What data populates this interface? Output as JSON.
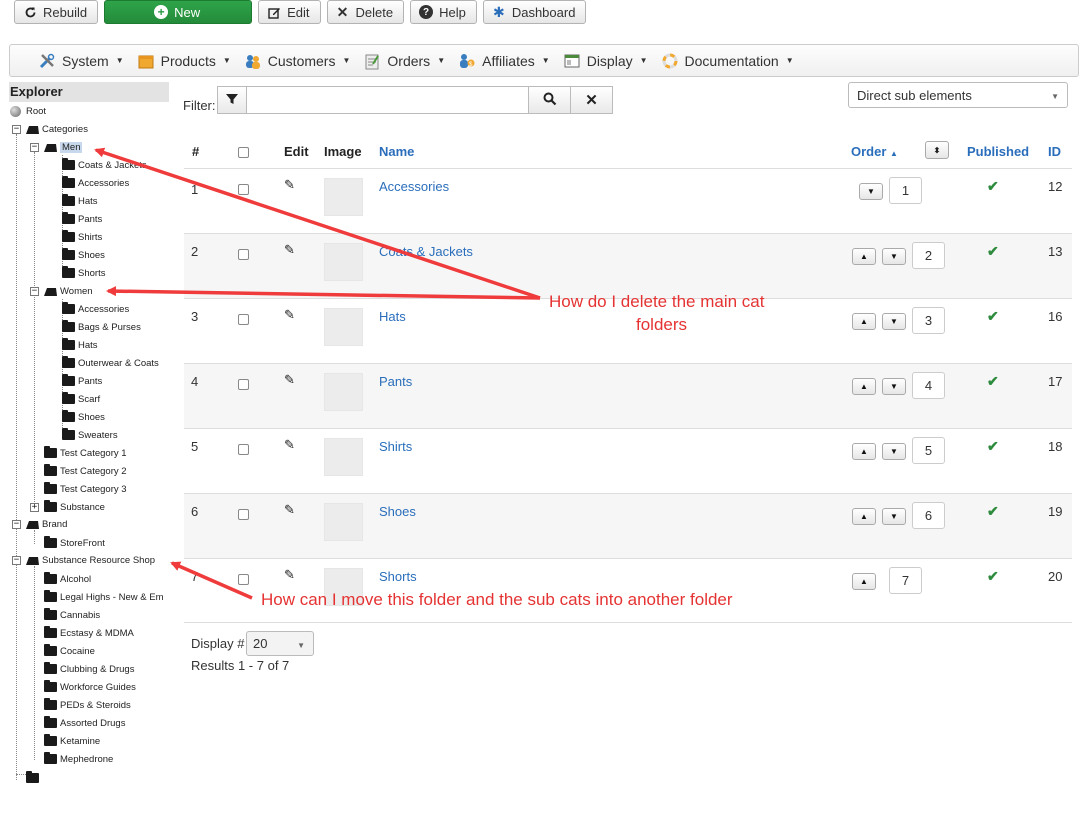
{
  "toolbar": {
    "rebuild": "Rebuild",
    "new": "New",
    "edit": "Edit",
    "delete": "Delete",
    "help": "Help",
    "dashboard": "Dashboard"
  },
  "menu": [
    "System",
    "Products",
    "Customers",
    "Orders",
    "Affiliates",
    "Display",
    "Documentation"
  ],
  "explorer": {
    "title": "Explorer",
    "root": "Root",
    "categories": "Categories",
    "men": "Men",
    "men_children": [
      "Coats & Jackets",
      "Accessories",
      "Hats",
      "Pants",
      "Shirts",
      "Shoes",
      "Shorts"
    ],
    "women": "Women",
    "women_children": [
      "Accessories",
      "Bags & Purses",
      "Hats",
      "Outerwear & Coats",
      "Pants",
      "Scarf",
      "Shoes",
      "Sweaters"
    ],
    "test_categories": [
      "Test Category 1",
      "Test Category 2",
      "Test Category 3"
    ],
    "substance": "Substance",
    "brand": "Brand",
    "storefront": "StoreFront",
    "substance_shop": "Substance Resource Shop",
    "shop_children": [
      "Alcohol",
      "Legal Highs - New & Em",
      "Cannabis",
      "Ecstasy & MDMA",
      "Cocaine",
      "Clubbing & Drugs",
      "Workforce Guides",
      "PEDs & Steroids",
      "Assorted Drugs",
      "Ketamine",
      "Mephedrone"
    ]
  },
  "filter": {
    "label": "Filter:",
    "value": "",
    "scope": "Direct sub elements"
  },
  "table": {
    "headers": {
      "num": "#",
      "edit": "Edit",
      "image": "Image",
      "name": "Name",
      "order": "Order",
      "published": "Published",
      "id": "ID"
    },
    "rows": [
      {
        "num": "1",
        "name": "Accessories",
        "order": "1",
        "id": "12"
      },
      {
        "num": "2",
        "name": "Coats & Jackets",
        "order": "2",
        "id": "13"
      },
      {
        "num": "3",
        "name": "Hats",
        "order": "3",
        "id": "16"
      },
      {
        "num": "4",
        "name": "Pants",
        "order": "4",
        "id": "17"
      },
      {
        "num": "5",
        "name": "Shirts",
        "order": "5",
        "id": "18"
      },
      {
        "num": "6",
        "name": "Shoes",
        "order": "6",
        "id": "19"
      },
      {
        "num": "7",
        "name": "Shorts",
        "order": "7",
        "id": "20"
      }
    ]
  },
  "pagination": {
    "display_label": "Display #",
    "display_value": "20",
    "results": "Results 1 - 7 of 7"
  },
  "annotations": {
    "delete_q_line1": "How do I delete the main cat",
    "delete_q_line2": "folders",
    "move_q": "How  can I move this folder and the sub cats  into another folder",
    "color": "#e53333"
  }
}
